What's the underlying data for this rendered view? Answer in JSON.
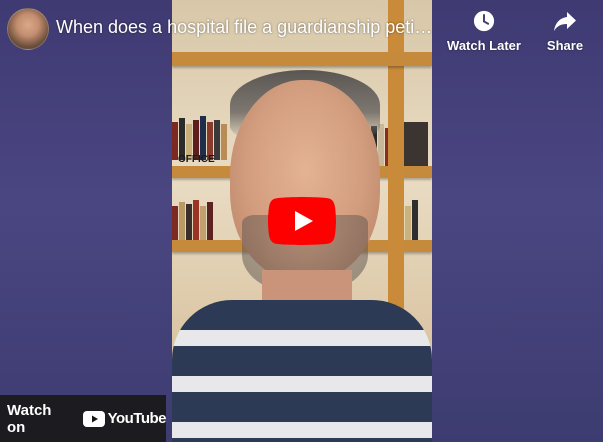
{
  "header": {
    "title": "When does a hospital file a guardianship petition? | Guardianship Lawyer",
    "watch_later_label": "Watch Later",
    "share_label": "Share"
  },
  "footer": {
    "watch_on_label": "Watch on",
    "youtube_label": "YouTube"
  },
  "video": {
    "shelf_sign_text": "OFFICE"
  },
  "colors": {
    "play_button": "#ff0000",
    "background": "#433f78",
    "watch_on_bg": "#171717"
  },
  "icons": [
    "clock-icon",
    "share-arrow-icon",
    "play-icon",
    "youtube-logo-icon"
  ]
}
